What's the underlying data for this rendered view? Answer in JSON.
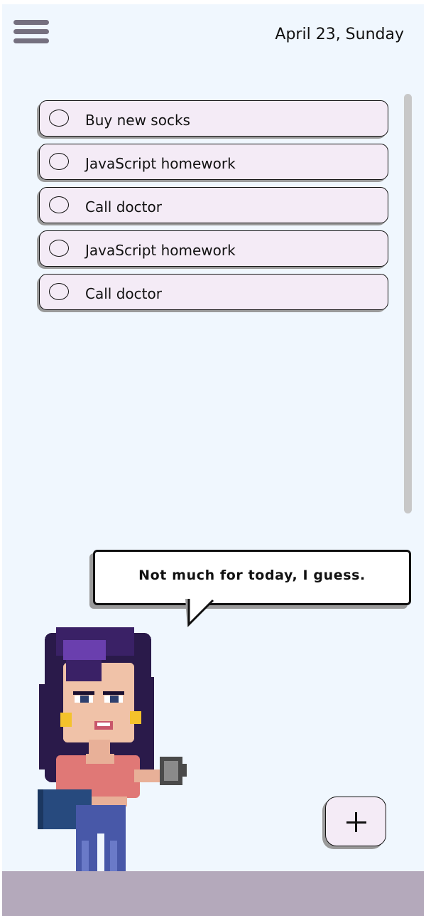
{
  "header": {
    "menu_icon": "hamburger-menu-icon",
    "date": "April 23, Sunday"
  },
  "tasks": [
    {
      "label": "Buy new socks",
      "done": false
    },
    {
      "label": " JavaScript homework",
      "done": false
    },
    {
      "label": "Call doctor",
      "done": false
    },
    {
      "label": " JavaScript homework",
      "done": false
    },
    {
      "label": "Call doctor",
      "done": false
    }
  ],
  "speech_bubble": {
    "text": "Not much for today, I guess."
  },
  "add_button": {
    "icon": "plus-icon"
  },
  "colors": {
    "background": "#f0f7fe",
    "task_fill": "#f4ebf6",
    "shadow": "#9a9a9a",
    "ground": "#b4a9bb",
    "menu_icon": "#75707f"
  }
}
